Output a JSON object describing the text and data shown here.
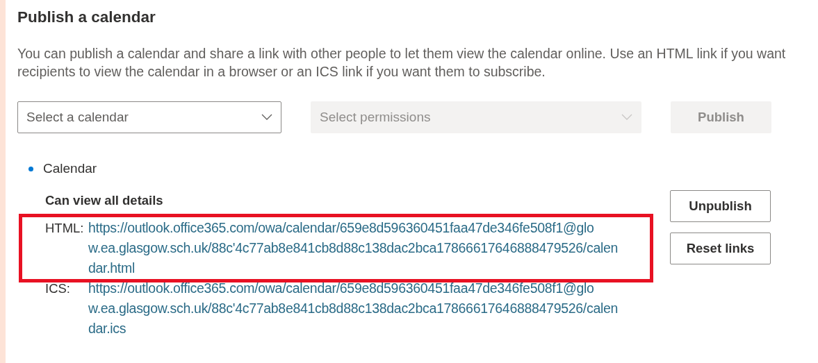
{
  "title": "Publish a calendar",
  "description": "You can publish a calendar and share a link with other people to let them view the calendar online. Use an HTML link if you want recipients to view the calendar in a browser or an ICS link if you want them to subscribe.",
  "controls": {
    "calendar_select": {
      "placeholder": "Select a calendar",
      "disabled": false
    },
    "permissions_select": {
      "placeholder": "Select permissions",
      "disabled": true
    },
    "publish_button": {
      "label": "Publish",
      "disabled": true
    }
  },
  "published": {
    "calendar": "Calendar",
    "color": "#0078d4",
    "permission": "Can view all details",
    "links": [
      {
        "label": "HTML:",
        "lines": [
          "https://outlook.office365.com/owa/calendar/659e8d596360451faa47de346fe508f1@glo",
          "w.ea.glasgow.sch.uk/88c'4c77ab8e841cb8d88c138dac2bca17866617646888479526/calen",
          "dar.html"
        ],
        "highlighted": true
      },
      {
        "label": "ICS:",
        "lines": [
          "https://outlook.office365.com/owa/calendar/659e8d596360451faa47de346fe508f1@glo",
          "w.ea.glasgow.sch.uk/88c'4c77ab8e841cb8d88c138dac2bca17866617646888479526/calen",
          "dar.ics"
        ],
        "highlighted": false
      }
    ],
    "buttons": [
      "Unpublish",
      "Reset links"
    ]
  }
}
